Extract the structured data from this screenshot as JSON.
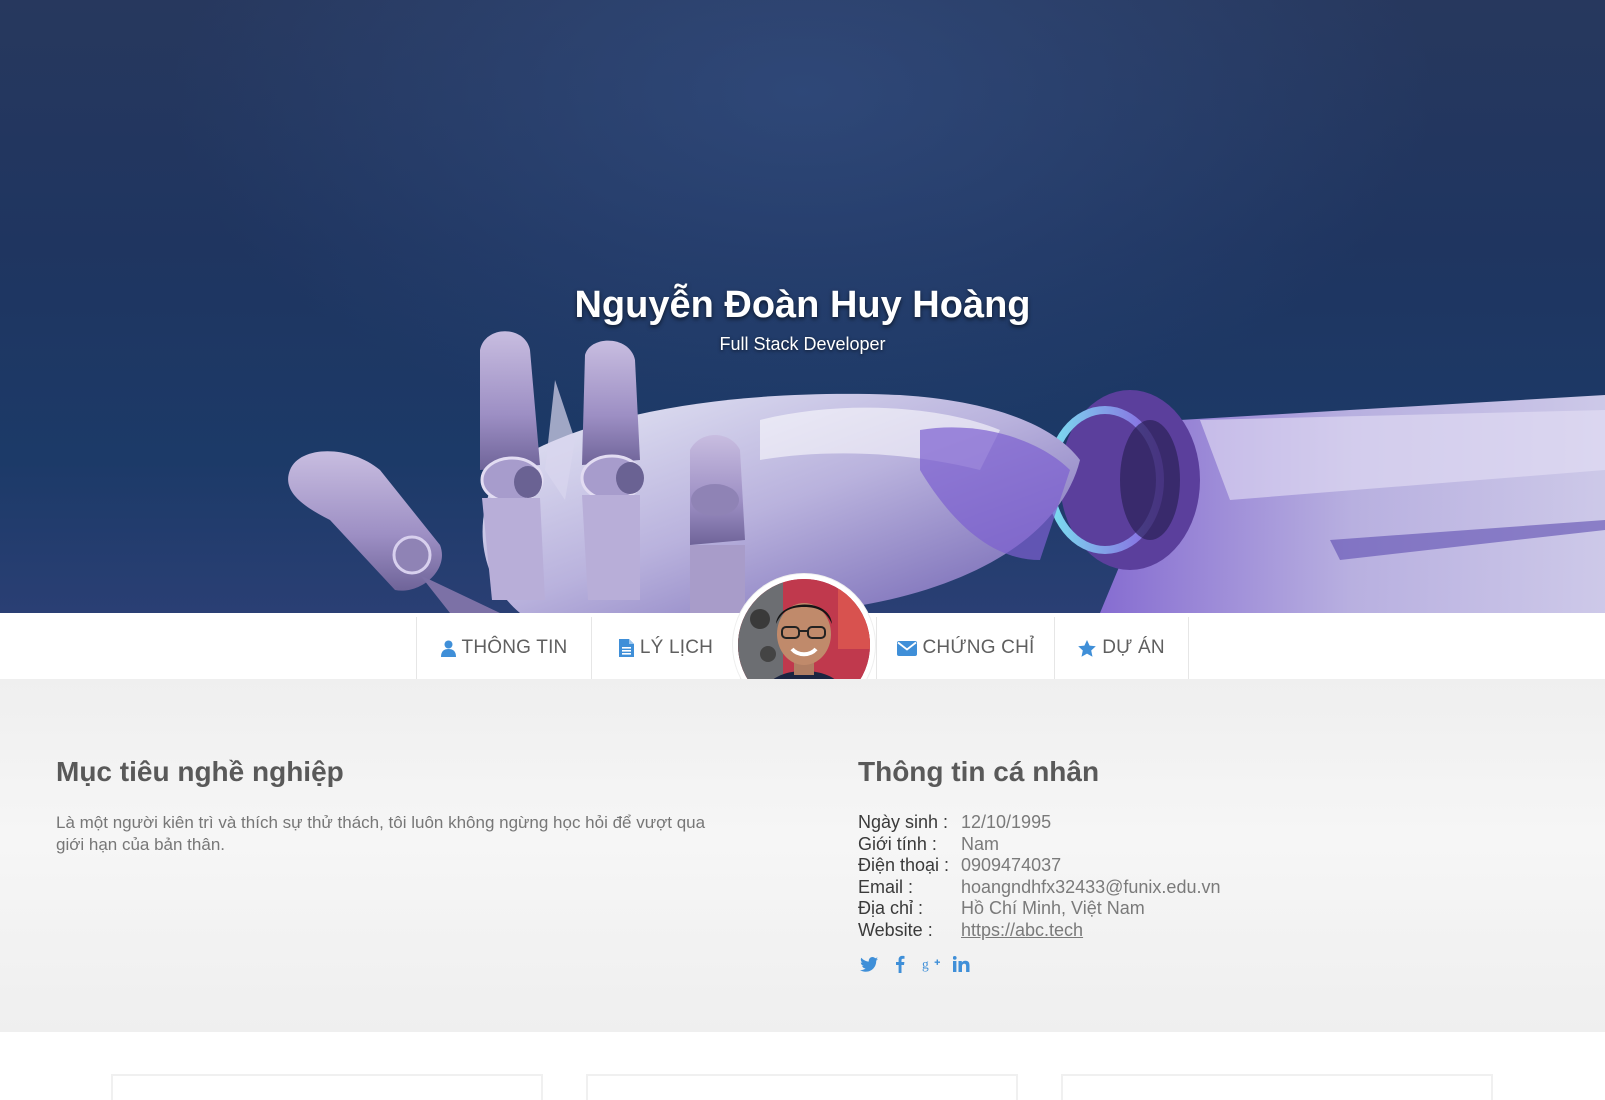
{
  "hero": {
    "name": "Nguyễn Đoàn Huy Hoàng",
    "role": "Full Stack Developer"
  },
  "nav": {
    "items": [
      {
        "label": "THÔNG TIN",
        "icon": "user-icon"
      },
      {
        "label": "LÝ LỊCH",
        "icon": "document-icon"
      },
      {
        "label": "CHỨNG CHỈ",
        "icon": "envelope-icon"
      },
      {
        "label": "DỰ ÁN",
        "icon": "star-icon"
      }
    ]
  },
  "career": {
    "title": "Mục tiêu nghề nghiệp",
    "text": "Là một người kiên trì và thích sự thử thách, tôi luôn không ngừng học hỏi để vượt qua giới hạn của bản thân."
  },
  "personal": {
    "title": "Thông tin cá nhân",
    "rows": [
      {
        "label": "Ngày sinh :",
        "value": "12/10/1995"
      },
      {
        "label": "Giới tính :",
        "value": "Nam"
      },
      {
        "label": "Điện thoại :",
        "value": "0909474037"
      },
      {
        "label": "Email :",
        "value": "hoangndhfx32433@funix.edu.vn"
      },
      {
        "label": "Địa chỉ :",
        "value": "Hồ Chí Minh, Việt Nam"
      },
      {
        "label": "Website :",
        "value": "https://abc.tech"
      }
    ]
  },
  "social": [
    "twitter-icon",
    "facebook-icon",
    "google-plus-icon",
    "linkedin-icon"
  ],
  "colors": {
    "accent": "#3f8fd8",
    "hero_bg": "#1f3560"
  }
}
